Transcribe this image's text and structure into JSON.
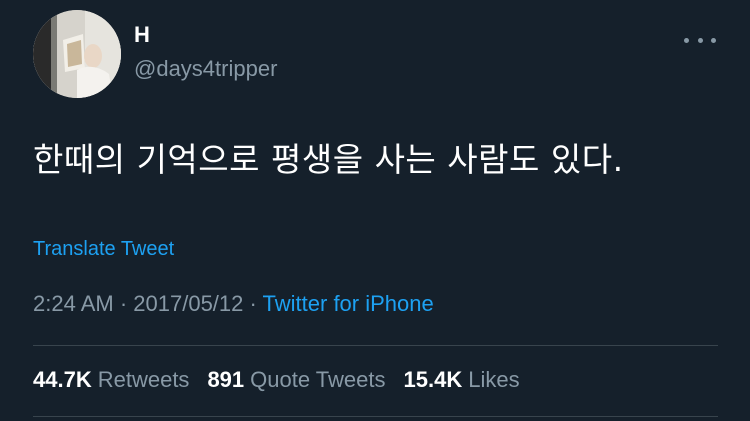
{
  "user": {
    "display_name": "H",
    "handle": "@days4tripper"
  },
  "tweet": {
    "text": "한때의 기억으로 평생을 사는 사람도 있다.",
    "translate_label": "Translate Tweet",
    "time": "2:24 AM",
    "separator": " · ",
    "date": "2017/05/12",
    "source": "Twitter for iPhone"
  },
  "stats": {
    "retweets_count": "44.7K",
    "retweets_label": "Retweets",
    "quote_count": "891",
    "quote_label": "Quote Tweets",
    "likes_count": "15.4K",
    "likes_label": "Likes"
  },
  "colors": {
    "background": "#15202b",
    "secondary_text": "#8899a6",
    "accent": "#1da1f2",
    "divider": "#38444d"
  },
  "icons": {
    "more": "more-horizontal-icon"
  }
}
